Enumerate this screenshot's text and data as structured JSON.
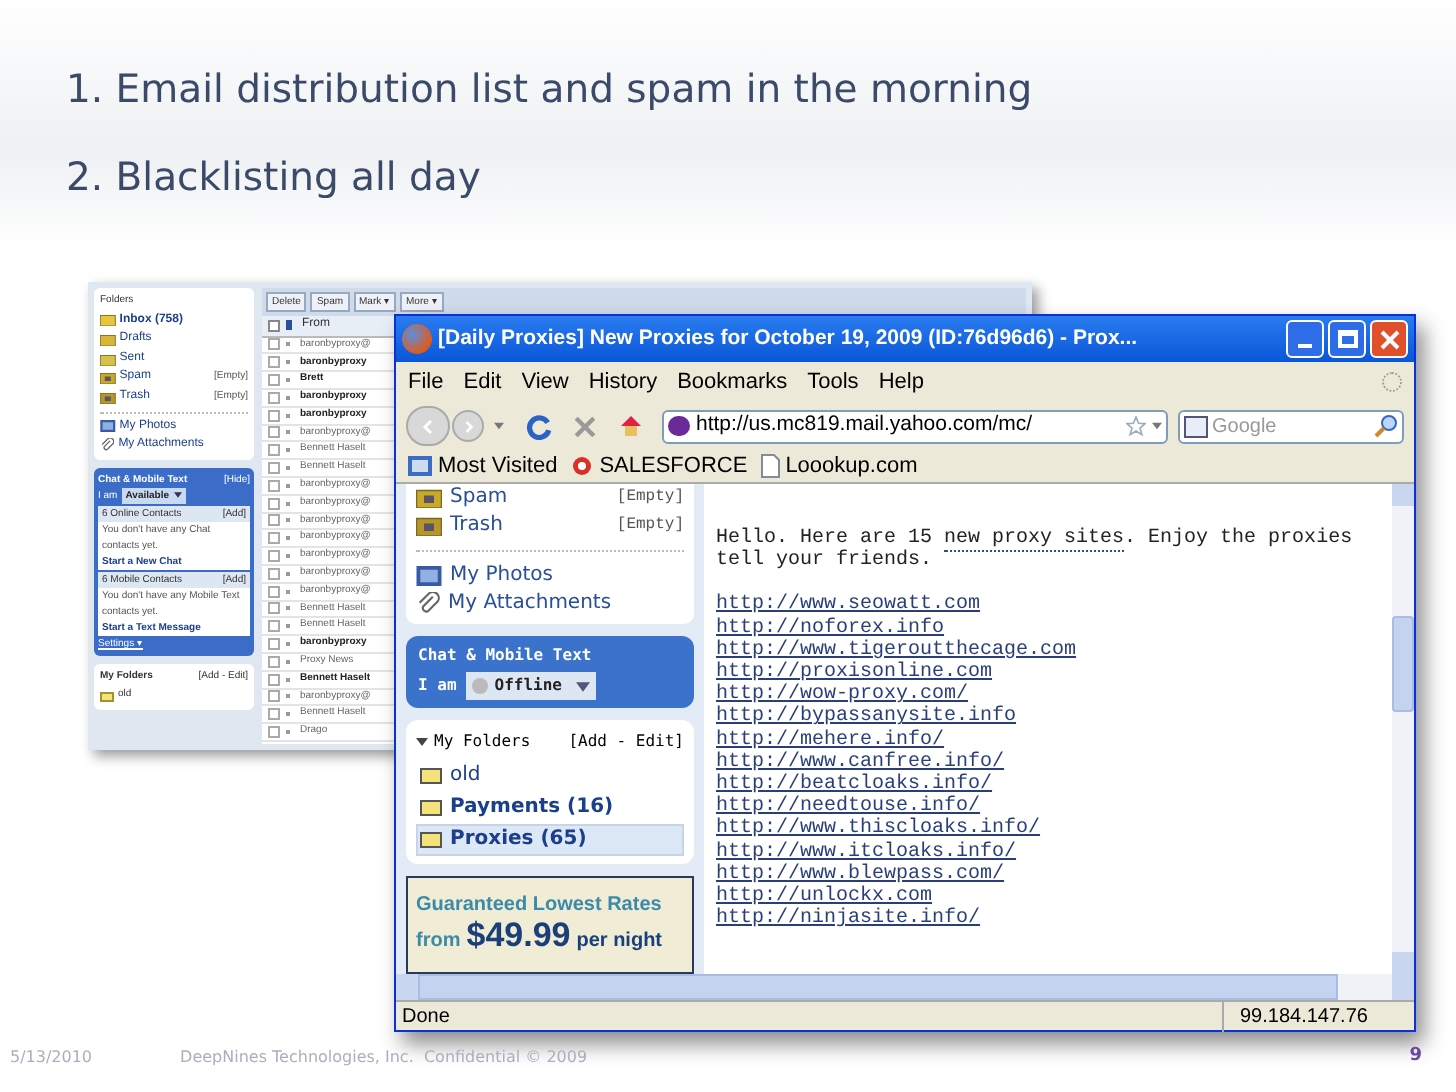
{
  "slide": {
    "points": [
      "1. Email distribution list and spam in the morning",
      "2. Blacklisting all day"
    ]
  },
  "back_mail": {
    "sidebar": {
      "folders_title": "Folders",
      "folders": [
        {
          "name": "Inbox (758)",
          "unread": true,
          "kind": "inbox"
        },
        {
          "name": "Drafts",
          "unread": false,
          "kind": "drafts"
        },
        {
          "name": "Sent",
          "unread": false,
          "kind": "sent"
        },
        {
          "name": "Spam",
          "action": "[Empty]",
          "unread": false,
          "kind": "spam"
        },
        {
          "name": "Trash",
          "action": "[Empty]",
          "unread": false,
          "kind": "trash"
        }
      ],
      "extras": [
        {
          "label": "My Photos",
          "kind": "photos"
        },
        {
          "label": "My Attachments",
          "kind": "attachments"
        }
      ],
      "chat": {
        "title": "Chat & Mobile Text",
        "hide": "[Hide]",
        "status_label": "I am",
        "status": "Available",
        "groups": [
          {
            "title": "6 Online Contacts",
            "add": "[Add]",
            "note": "You don't have any Chat contacts yet.",
            "action": "Start a New Chat"
          },
          {
            "title": "6 Mobile Contacts",
            "add": "[Add]",
            "note": "You don't have any Mobile Text contacts yet.",
            "action": "Start a Text Message"
          }
        ],
        "settings": "Settings ▾"
      },
      "my_folders": {
        "title": "My Folders",
        "edit": "[Add - Edit]",
        "items": [
          {
            "name": "old",
            "unread": false
          }
        ]
      }
    },
    "toolbar": [
      "Delete",
      "Spam",
      "Mark ▾",
      "More ▾"
    ],
    "from_header": "From",
    "select_all_checked": false,
    "rows": [
      {
        "from": "baronbyproxy@",
        "unread": false,
        "checked": false
      },
      {
        "from": "baronbyproxy",
        "unread": true,
        "checked": false
      },
      {
        "from": "Brett",
        "unread": true,
        "checked": false
      },
      {
        "from": "baronbyproxy",
        "unread": true,
        "checked": false
      },
      {
        "from": "baronbyproxy",
        "unread": true,
        "checked": false
      },
      {
        "from": "baronbyproxy@",
        "unread": false,
        "checked": false
      },
      {
        "from": "Bennett Haselt",
        "unread": false,
        "checked": false
      },
      {
        "from": "Bennett Haselt",
        "unread": false,
        "checked": false
      },
      {
        "from": "baronbyproxy@",
        "unread": false,
        "checked": false
      },
      {
        "from": "baronbyproxy@",
        "unread": false,
        "checked": false
      },
      {
        "from": "baronbyproxy@",
        "unread": false,
        "checked": false
      },
      {
        "from": "baronbyproxy@",
        "unread": false,
        "checked": false
      },
      {
        "from": "baronbyproxy@",
        "unread": false,
        "checked": false
      },
      {
        "from": "baronbyproxy@",
        "unread": false,
        "checked": false
      },
      {
        "from": "baronbyproxy@",
        "unread": false,
        "checked": false
      },
      {
        "from": "Bennett Haselt",
        "unread": false,
        "checked": false
      },
      {
        "from": "Bennett Haselt",
        "unread": false,
        "checked": false
      },
      {
        "from": "baronbyproxy",
        "unread": true,
        "checked": false
      },
      {
        "from": "Proxy News",
        "unread": false,
        "checked": false
      },
      {
        "from": "Bennett Haselt",
        "unread": true,
        "checked": false
      },
      {
        "from": "baronbyproxy@",
        "unread": false,
        "checked": false
      },
      {
        "from": "Bennett Haselt",
        "unread": false,
        "checked": false
      },
      {
        "from": "Drago",
        "unread": false,
        "checked": false
      }
    ]
  },
  "browser": {
    "title": "[Daily Proxies] New Proxies for October 19, 2009 (ID:76d96d6) - Prox...",
    "menu": [
      "File",
      "Edit",
      "View",
      "History",
      "Bookmarks",
      "Tools",
      "Help"
    ],
    "url": "http://us.mc819.mail.yahoo.com/mc/",
    "search_placeholder": "Google",
    "bookmarks": [
      {
        "label": "Most Visited",
        "kind": "folder"
      },
      {
        "label": "SALESFORCE",
        "kind": "salesforce"
      },
      {
        "label": "Loookup.com",
        "kind": "page"
      }
    ],
    "sidebar": {
      "folders": [
        {
          "name": "Spam",
          "action": "[Empty]",
          "kind": "spam"
        },
        {
          "name": "Trash",
          "action": "[Empty]",
          "kind": "trash"
        }
      ],
      "extras": [
        {
          "label": "My Photos",
          "kind": "photos"
        },
        {
          "label": "My Attachments",
          "kind": "attachments"
        }
      ],
      "chat": {
        "title": "Chat & Mobile Text",
        "status_label": "I am",
        "status": "Offline"
      },
      "my_folders": {
        "title": "My Folders",
        "edit": "[Add - Edit]",
        "items": [
          {
            "name": "old",
            "unread": false,
            "selected": false
          },
          {
            "name": "Payments (16)",
            "unread": true,
            "selected": false
          },
          {
            "name": "Proxies (65)",
            "unread": true,
            "selected": true
          }
        ]
      },
      "ad": {
        "headline": "Guaranteed Lowest Rates",
        "from": "from",
        "price": "$49.99",
        "unit": "per night"
      }
    },
    "message": {
      "intro_before": "Hello. Here are 15 ",
      "intro_link": "new proxy sites",
      "intro_after": ". Enjoy the proxies",
      "intro_line2": "tell your friends.",
      "links": [
        "http://www.seowatt.com",
        "http://noforex.info",
        "http://www.tigeroutthecage.com",
        "http://proxisonline.com",
        "http://wow-proxy.com/",
        "http://bypassanysite.info",
        "http://mehere.info/",
        "http://www.canfree.info/",
        "http://beatcloaks.info/",
        "http://needtouse.info/",
        "http://www.thiscloaks.info/",
        "http://www.itcloaks.info/",
        "http://www.blewpass.com/",
        "http://unlockx.com",
        "http://ninjasite.info/"
      ]
    },
    "status": {
      "text": "Done",
      "ip": "99.184.147.76"
    }
  },
  "footer": {
    "date": "5/13/2010",
    "company": "DeepNines Technologies, Inc.  Confidential © 2009",
    "page": "9"
  }
}
